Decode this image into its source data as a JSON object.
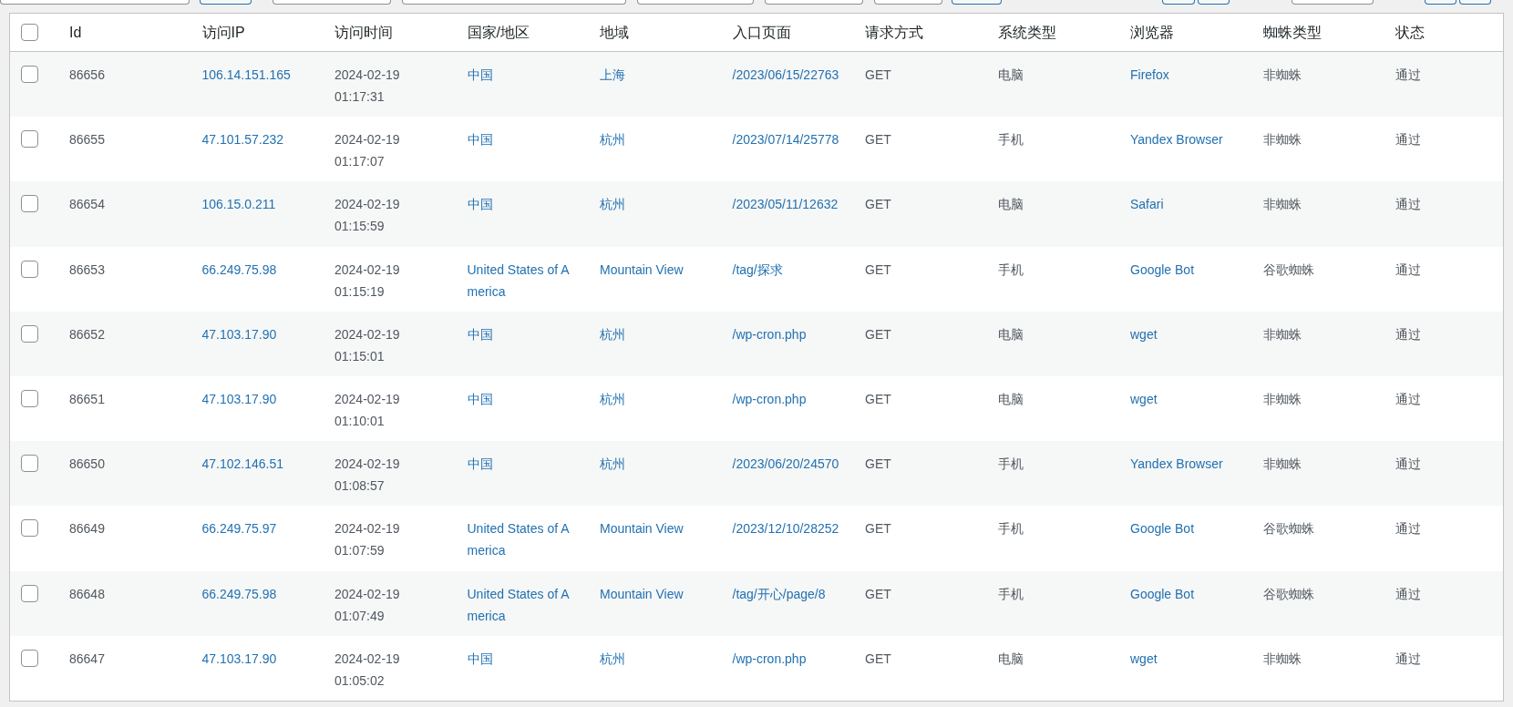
{
  "table": {
    "select_all": {
      "checked": false
    },
    "columns": [
      "Id",
      "访问IP",
      "访问时间",
      "国家/地区",
      "地域",
      "入口页面",
      "请求方式",
      "系统类型",
      "浏览器",
      "蜘蛛类型",
      "状态"
    ],
    "rows": [
      {
        "checked": false,
        "id": "86656",
        "ip": "106.14.151.165",
        "date": "2024-02-19",
        "time": "01:17:31",
        "country": "中国",
        "region": "上海",
        "page": "/2023/06/15/22763",
        "method": "GET",
        "os": "电脑",
        "browser": "Firefox",
        "spider": "非蜘蛛",
        "status": "通过"
      },
      {
        "checked": false,
        "id": "86655",
        "ip": "47.101.57.232",
        "date": "2024-02-19",
        "time": "01:17:07",
        "country": "中国",
        "region": "杭州",
        "page": "/2023/07/14/25778",
        "method": "GET",
        "os": "手机",
        "browser": "Yandex Browser",
        "spider": "非蜘蛛",
        "status": "通过"
      },
      {
        "checked": false,
        "id": "86654",
        "ip": "106.15.0.211",
        "date": "2024-02-19",
        "time": "01:15:59",
        "country": "中国",
        "region": "杭州",
        "page": "/2023/05/11/12632",
        "method": "GET",
        "os": "电脑",
        "browser": "Safari",
        "spider": "非蜘蛛",
        "status": "通过"
      },
      {
        "checked": false,
        "id": "86653",
        "ip": "66.249.75.98",
        "date": "2024-02-19",
        "time": "01:15:19",
        "country": "United States of America",
        "region": "Mountain View",
        "page": "/tag/探求",
        "method": "GET",
        "os": "手机",
        "browser": "Google Bot",
        "spider": "谷歌蜘蛛",
        "status": "通过"
      },
      {
        "checked": false,
        "id": "86652",
        "ip": "47.103.17.90",
        "date": "2024-02-19",
        "time": "01:15:01",
        "country": "中国",
        "region": "杭州",
        "page": "/wp-cron.php",
        "method": "GET",
        "os": "电脑",
        "browser": "wget",
        "spider": "非蜘蛛",
        "status": "通过"
      },
      {
        "checked": false,
        "id": "86651",
        "ip": "47.103.17.90",
        "date": "2024-02-19",
        "time": "01:10:01",
        "country": "中国",
        "region": "杭州",
        "page": "/wp-cron.php",
        "method": "GET",
        "os": "电脑",
        "browser": "wget",
        "spider": "非蜘蛛",
        "status": "通过"
      },
      {
        "checked": false,
        "id": "86650",
        "ip": "47.102.146.51",
        "date": "2024-02-19",
        "time": "01:08:57",
        "country": "中国",
        "region": "杭州",
        "page": "/2023/06/20/24570",
        "method": "GET",
        "os": "手机",
        "browser": "Yandex Browser",
        "spider": "非蜘蛛",
        "status": "通过"
      },
      {
        "checked": false,
        "id": "86649",
        "ip": "66.249.75.97",
        "date": "2024-02-19",
        "time": "01:07:59",
        "country": "United States of America",
        "region": "Mountain View",
        "page": "/2023/12/10/28252",
        "method": "GET",
        "os": "手机",
        "browser": "Google Bot",
        "spider": "谷歌蜘蛛",
        "status": "通过"
      },
      {
        "checked": false,
        "id": "86648",
        "ip": "66.249.75.98",
        "date": "2024-02-19",
        "time": "01:07:49",
        "country": "United States of America",
        "region": "Mountain View",
        "page": "/tag/开心/page/8",
        "method": "GET",
        "os": "手机",
        "browser": "Google Bot",
        "spider": "谷歌蜘蛛",
        "status": "通过"
      },
      {
        "checked": false,
        "id": "86647",
        "ip": "47.103.17.90",
        "date": "2024-02-19",
        "time": "01:05:02",
        "country": "中国",
        "region": "杭州",
        "page": "/wp-cron.php",
        "method": "GET",
        "os": "电脑",
        "browser": "wget",
        "spider": "非蜘蛛",
        "status": "通过"
      }
    ]
  }
}
